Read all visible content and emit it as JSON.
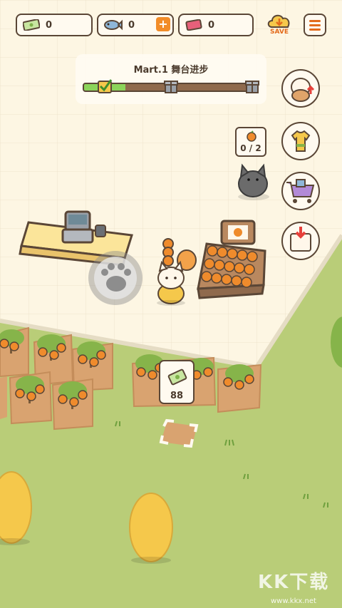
{
  "hud": {
    "cash": "0",
    "fish": "0",
    "ticket": "0",
    "add_label": "+",
    "save_label": "SAVE"
  },
  "progress": {
    "title": "Mart.1 舞台进步",
    "fill_fraction": 0.24
  },
  "order": {
    "count": "0 / 2"
  },
  "plot_price": "88",
  "side_menu": [
    "staff-upgrade-icon",
    "outfit-shirt-icon",
    "shop-cart-icon",
    "task-list-icon"
  ],
  "watermark": {
    "brand": "KK下载",
    "url": "www.kkx.net"
  },
  "colors": {
    "floor": "#fdf6e3",
    "grass": "#b9cd78",
    "outline": "#5a4636",
    "accent": "#f28c28",
    "progress_fill": "#8bd45a"
  }
}
